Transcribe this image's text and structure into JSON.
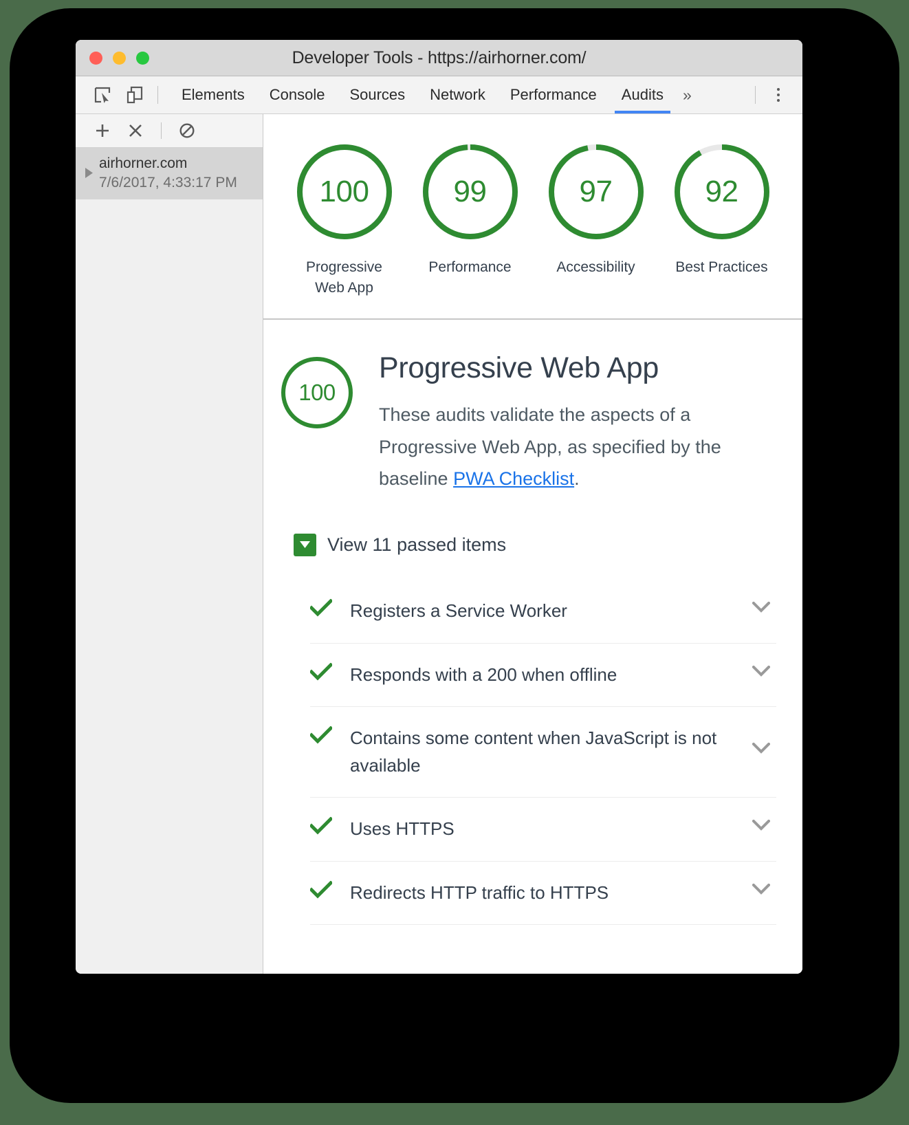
{
  "window": {
    "title": "Developer Tools - https://airhorner.com/",
    "traffic_lights": [
      "close-red",
      "minimize-yellow",
      "maximize-green"
    ]
  },
  "tabbar": {
    "icons": [
      {
        "name": "inspect-element-icon"
      },
      {
        "name": "device-toolbar-icon"
      }
    ],
    "tabs": [
      {
        "label": "Elements",
        "active": false
      },
      {
        "label": "Console",
        "active": false
      },
      {
        "label": "Sources",
        "active": false
      },
      {
        "label": "Network",
        "active": false
      },
      {
        "label": "Performance",
        "active": false
      },
      {
        "label": "Audits",
        "active": true
      }
    ],
    "overflow_label": "»",
    "menu_icon": "kebab-menu-icon",
    "active_underline_color": "#4285f4"
  },
  "sidebar": {
    "toolbar": [
      {
        "name": "add-audit-button",
        "label": "+"
      },
      {
        "name": "delete-audit-button",
        "label": "×"
      },
      {
        "name": "clear-all-button",
        "label": "⊘"
      }
    ],
    "items": [
      {
        "host": "airhorner.com",
        "timestamp": "7/6/2017, 4:33:17 PM",
        "selected": true,
        "expander": "collapsed-triangle-icon"
      }
    ]
  },
  "scores": {
    "accent_green": "#2e8b31",
    "track_gray": "#e8e8e8",
    "gauges": [
      {
        "value": "100",
        "score": 100,
        "label": "Progressive Web App"
      },
      {
        "value": "99",
        "score": 99,
        "label": "Performance"
      },
      {
        "value": "97",
        "score": 97,
        "label": "Accessibility"
      },
      {
        "value": "92",
        "score": 92,
        "label": "Best Practices"
      }
    ]
  },
  "category": {
    "score_value": "100",
    "score": 100,
    "title": "Progressive Web App",
    "description_before": "These audits validate the aspects of a Progressive Web App, as specified by the baseline ",
    "link_text": "PWA Checklist",
    "description_after": ".",
    "link_color": "#1a73e8"
  },
  "passed": {
    "toggle_label": "View 11 passed items",
    "count": 11,
    "expanded": true,
    "toggle_icon": "triangle-down-icon",
    "items": [
      {
        "title": "Registers a Service Worker",
        "status": "pass",
        "status_icon": "checkmark-icon",
        "expander": "chevron-down-icon"
      },
      {
        "title": "Responds with a 200 when offline",
        "status": "pass",
        "status_icon": "checkmark-icon",
        "expander": "chevron-down-icon"
      },
      {
        "title": "Contains some content when JavaScript is not available",
        "status": "pass",
        "status_icon": "checkmark-icon",
        "expander": "chevron-down-icon"
      },
      {
        "title": "Uses HTTPS",
        "status": "pass",
        "status_icon": "checkmark-icon",
        "expander": "chevron-down-icon"
      },
      {
        "title": "Redirects HTTP traffic to HTTPS",
        "status": "pass",
        "status_icon": "checkmark-icon",
        "expander": "chevron-down-icon"
      }
    ]
  }
}
